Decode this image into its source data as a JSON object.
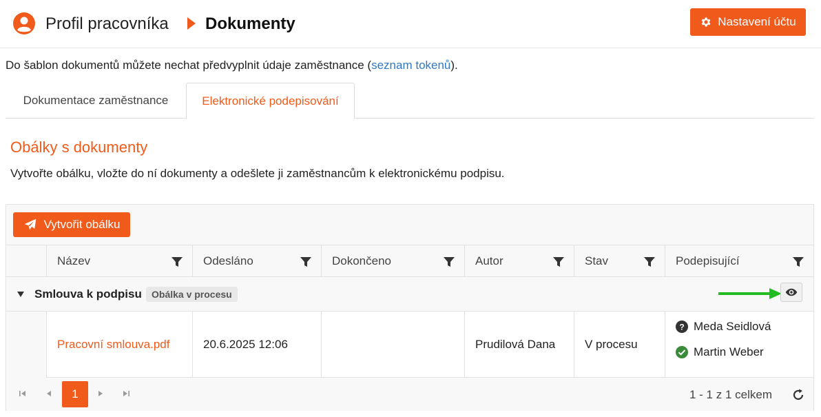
{
  "header": {
    "breadcrumb_profile": "Profil pracovníka",
    "breadcrumb_current": "Dokumenty",
    "settings_button": "Nastavení účtu"
  },
  "intro": {
    "text_before": "Do šablon dokumentů můžete nechat předvyplnit údaje zaměstnance (",
    "link": "seznam tokenů",
    "text_after": ")."
  },
  "tabs": [
    {
      "label": "Dokumentace zaměstnance",
      "active": false
    },
    {
      "label": "Elektronické podepisování",
      "active": true
    }
  ],
  "section": {
    "title": "Obálky s dokumenty",
    "description": "Vytvořte obálku, vložte do ní dokumenty a odešlete ji zaměstnancům k elektronickému podpisu."
  },
  "toolbar": {
    "create_button": "Vytvořit obálku"
  },
  "columns": [
    "Název",
    "Odesláno",
    "Dokončeno",
    "Autor",
    "Stav",
    "Podepisující"
  ],
  "group": {
    "title": "Smlouva k podpisu",
    "badge": "Obálka v procesu"
  },
  "rows": [
    {
      "name": "Pracovní smlouva.pdf",
      "sent": "20.6.2025 12:06",
      "completed": "",
      "author": "Prudilová Dana",
      "status": "V procesu",
      "signers": [
        {
          "name": "Meda Seidlová",
          "state": "pending",
          "icon": "question-circle-icon"
        },
        {
          "name": "Martin Weber",
          "state": "signed",
          "icon": "check-circle-icon"
        }
      ]
    }
  ],
  "pager": {
    "current_page": "1",
    "info": "1 - 1 z 1 celkem"
  },
  "colors": {
    "accent": "#f05a1a",
    "link": "#2f78c4",
    "pending": "#333333",
    "signed": "#3a8a3a",
    "annotation_arrow": "#22bb22"
  }
}
